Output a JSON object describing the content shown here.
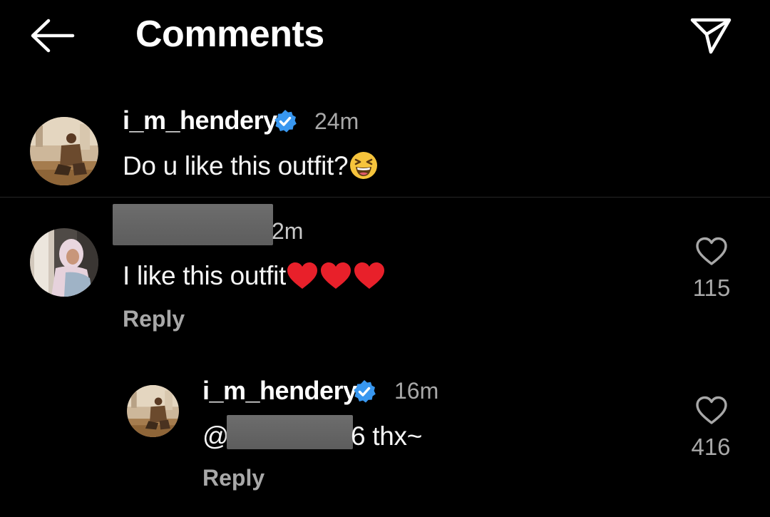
{
  "header": {
    "title": "Comments",
    "back_icon": "arrow-left-icon",
    "send_icon": "paper-plane-icon"
  },
  "caption": {
    "username": "i_m_hendery",
    "verified_icon": "verified-badge-icon",
    "time": "24m",
    "text": "Do u like this outfit?",
    "emoji": "😆"
  },
  "comment": {
    "time": "2m",
    "text": "I like this outfit",
    "emojis": "❤️❤️❤️",
    "reply_label": "Reply",
    "like_count": "115",
    "heart_icon": "heart-outline-icon"
  },
  "reply": {
    "username": "i_m_hendery",
    "verified_icon": "verified-badge-icon",
    "time": "16m",
    "mention_prefix": "@",
    "text_suffix": "6 thx~",
    "reply_label": "Reply",
    "like_count": "416",
    "heart_icon": "heart-outline-icon"
  },
  "colors": {
    "background": "#000000",
    "text": "#ffffff",
    "secondary": "#a8a8a8",
    "verified": "#3897f0",
    "heart_red": "#e8202a"
  }
}
